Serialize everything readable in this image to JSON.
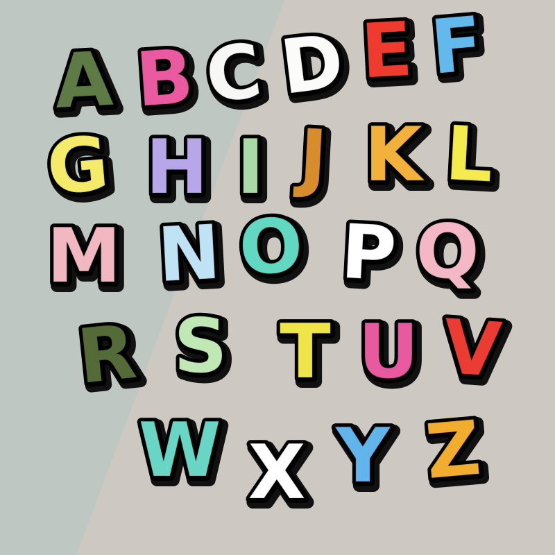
{
  "scene": {
    "background_left": "#bfc7c2",
    "background_right": "#cdc8c1",
    "patch_back": "#111111",
    "patch_border": "#000000",
    "letters": [
      {
        "char": "A",
        "color": "#5f7b45"
      },
      {
        "char": "B",
        "color": "#ea5aa1"
      },
      {
        "char": "C",
        "color": "#f7f7f5"
      },
      {
        "char": "D",
        "color": "#fbfbf9"
      },
      {
        "char": "E",
        "color": "#ef3b2f"
      },
      {
        "char": "F",
        "color": "#63b9ec"
      },
      {
        "char": "G",
        "color": "#f4eb6b"
      },
      {
        "char": "H",
        "color": "#b7a7ea"
      },
      {
        "char": "I",
        "color": "#a8d9a7"
      },
      {
        "char": "J",
        "color": "#d88d2d"
      },
      {
        "char": "K",
        "color": "#f2b13b"
      },
      {
        "char": "L",
        "color": "#f4ec4d"
      },
      {
        "char": "M",
        "color": "#f1b8c1"
      },
      {
        "char": "N",
        "color": "#bfe3f4"
      },
      {
        "char": "O",
        "color": "#62d7c2"
      },
      {
        "char": "P",
        "color": "#ffffff"
      },
      {
        "char": "Q",
        "color": "#f3b7c6"
      },
      {
        "char": "R",
        "color": "#546b38"
      },
      {
        "char": "S",
        "color": "#bfe8b5"
      },
      {
        "char": "T",
        "color": "#f0e44b"
      },
      {
        "char": "U",
        "color": "#e85aa0"
      },
      {
        "char": "V",
        "color": "#ea3c33"
      },
      {
        "char": "W",
        "color": "#69d6c5"
      },
      {
        "char": "X",
        "color": "#ffffff"
      },
      {
        "char": "Y",
        "color": "#62b5ea"
      },
      {
        "char": "Z",
        "color": "#f1ad2d"
      }
    ]
  }
}
